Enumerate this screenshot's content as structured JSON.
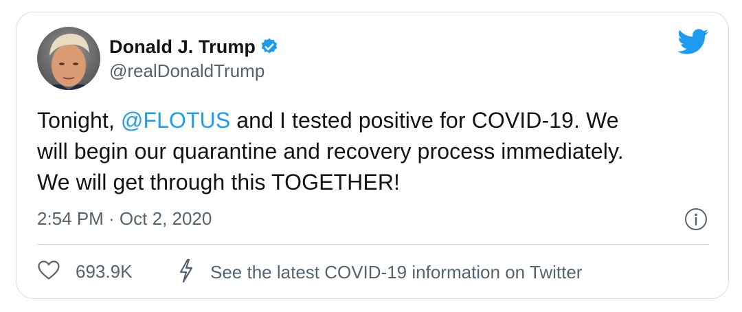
{
  "tweet": {
    "author": {
      "display_name": "Donald J. Trump",
      "handle": "@realDonaldTrump",
      "verified": true
    },
    "text": {
      "line1_prefix": "Tonight, ",
      "mention": "@FLOTUS",
      "line1_suffix": " and I tested positive for COVID-19. We",
      "line2": "will begin our quarantine and recovery process immediately.",
      "line3": "We will get through this TOGETHER!"
    },
    "timestamp": "2:54 PM · Oct 2, 2020",
    "likes": "693.9K",
    "covid_link": "See the latest COVID-19 information on Twitter"
  },
  "icons": {
    "brand": "twitter-bird-icon",
    "verified": "verified-badge-icon",
    "info": "info-icon",
    "like": "heart-icon",
    "covid": "lightning-bolt-icon"
  },
  "colors": {
    "accent": "#1d9bf0",
    "text": "#0f1419",
    "secondary": "#536471",
    "border": "#d6dee4"
  }
}
